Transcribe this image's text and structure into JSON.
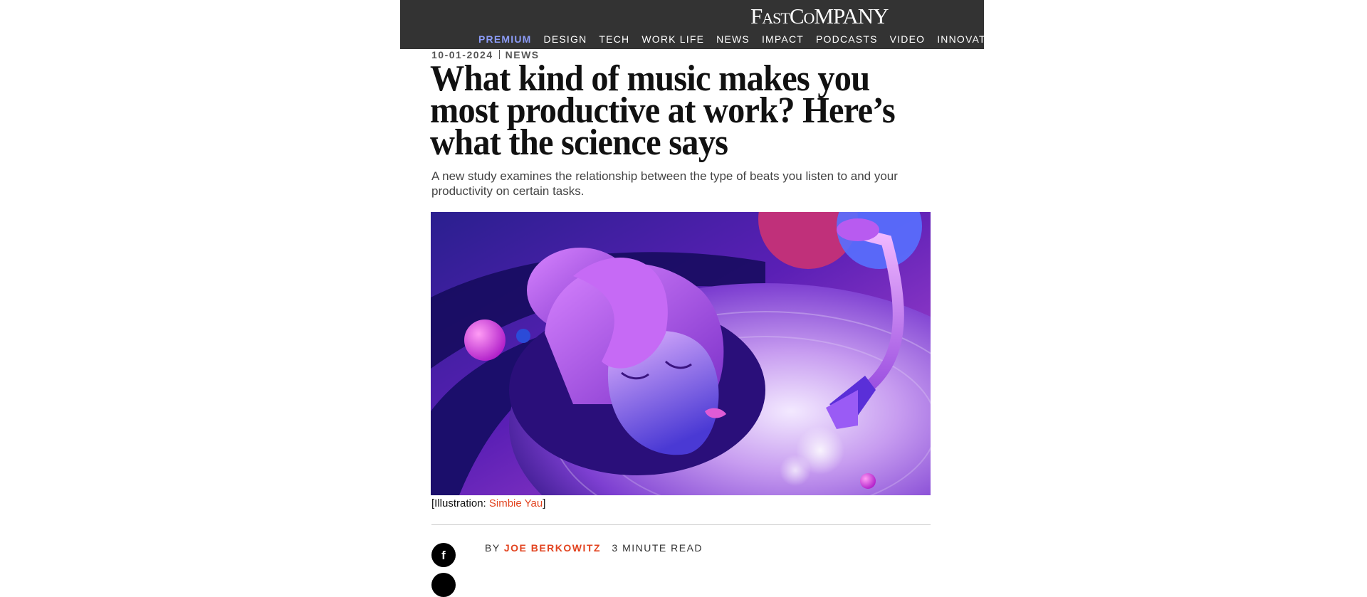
{
  "header": {
    "logo_text": "FAST COMPANY",
    "nav": [
      {
        "label": "PREMIUM"
      },
      {
        "label": "DESIGN"
      },
      {
        "label": "TECH"
      },
      {
        "label": "WORK LIFE"
      },
      {
        "label": "NEWS"
      },
      {
        "label": "IMPACT"
      },
      {
        "label": "PODCASTS"
      },
      {
        "label": "VIDEO"
      },
      {
        "label": "INNOVATION FEST"
      }
    ]
  },
  "article": {
    "date": "10-01-2024",
    "category": "NEWS",
    "headline": "What kind of music makes you most productive at work? Here’s what the science says",
    "dek": "A new study examines the relationship between the type of beats you listen to and your productivity on certain tasks.",
    "caption_prefix": "[Illustration: ",
    "caption_credit": "Simbie Yau",
    "caption_suffix": "]",
    "byline_prefix": "BY",
    "author": "JOE BERKOWITZ",
    "read_time": "3 MINUTE READ"
  },
  "icons": {
    "facebook": "facebook-icon",
    "share": "share-icon"
  },
  "colors": {
    "header_bg": "#333333",
    "premium": "#8c9cf7",
    "accent": "#e2431f"
  }
}
